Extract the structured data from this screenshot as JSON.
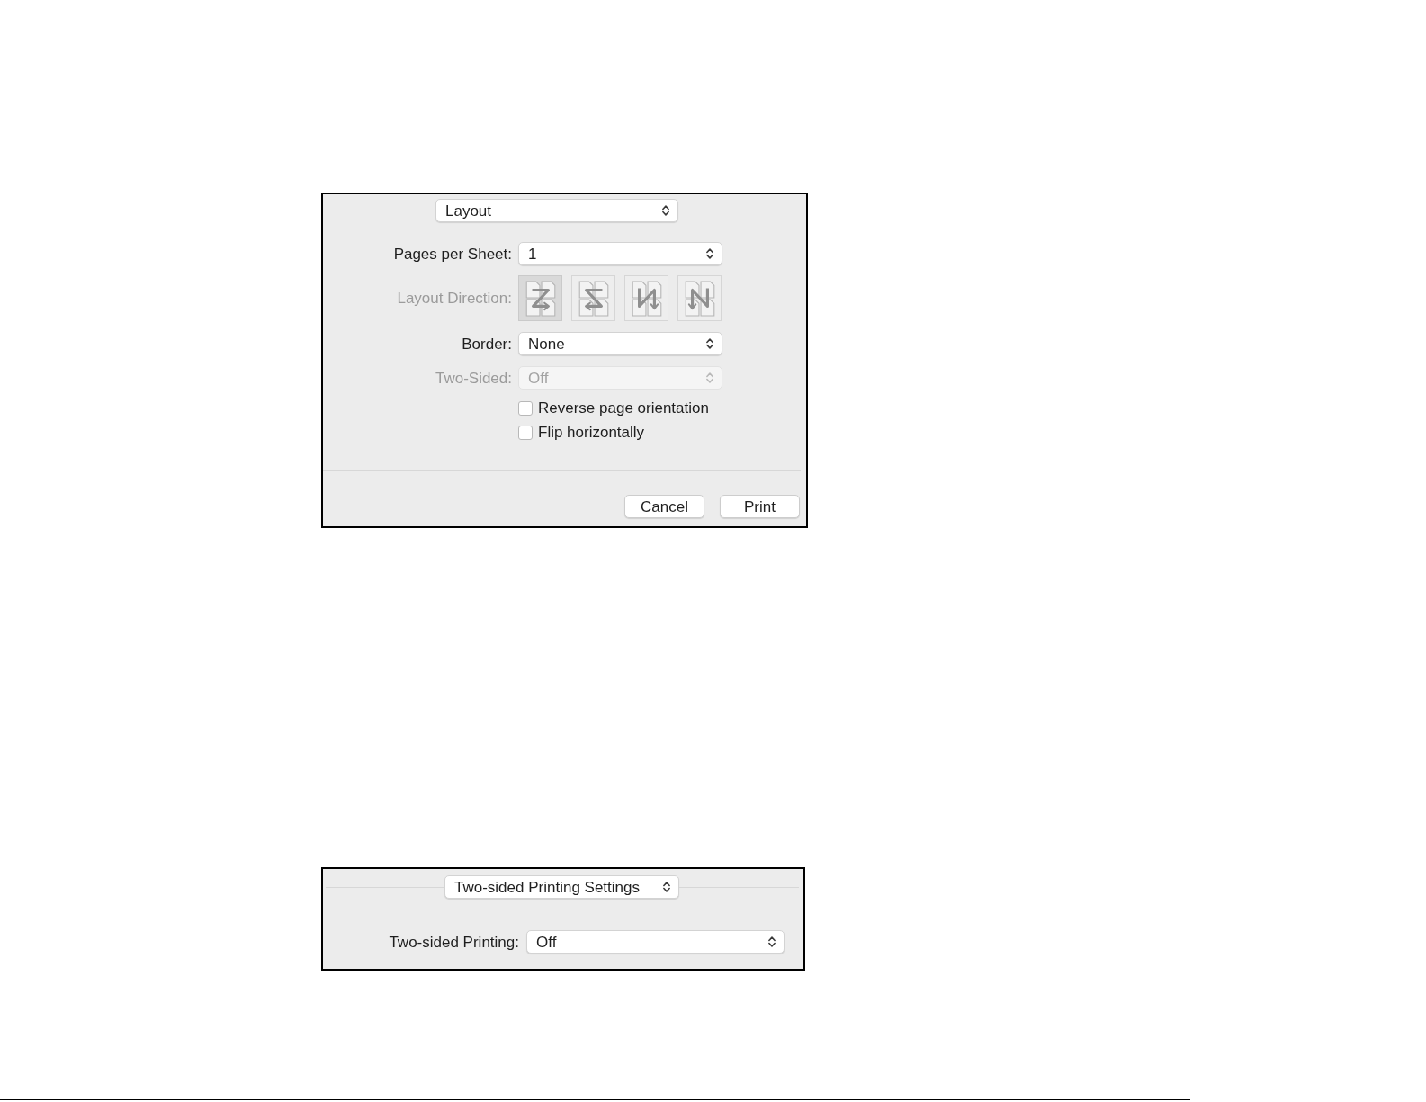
{
  "print_panels": [
    {
      "panel_menu": {
        "value": "Layout"
      },
      "rows": [
        {
          "kind": "popup",
          "label": "Pages per Sheet:",
          "value": "1",
          "disabled": false
        },
        {
          "kind": "direction",
          "label": "Layout Direction:",
          "disabled": true,
          "options": [
            {
              "selected": true
            },
            {
              "selected": false
            },
            {
              "selected": false
            },
            {
              "selected": false
            }
          ]
        },
        {
          "kind": "popup",
          "label": "Border:",
          "value": "None",
          "disabled": false
        },
        {
          "kind": "popup",
          "label": "Two-Sided:",
          "value": "Off",
          "disabled": true
        },
        {
          "kind": "checkbox",
          "label": "Reverse page orientation",
          "checked": false
        },
        {
          "kind": "checkbox",
          "label": "Flip horizontally",
          "checked": false
        }
      ],
      "buttons": [
        {
          "label": "Cancel"
        },
        {
          "label": "Print"
        }
      ]
    },
    {
      "panel_menu": {
        "value": "Two-sided Printing Settings"
      },
      "rows": [
        {
          "kind": "popup",
          "label": "Two-sided Printing:",
          "value": "Off",
          "disabled": false
        }
      ]
    }
  ]
}
